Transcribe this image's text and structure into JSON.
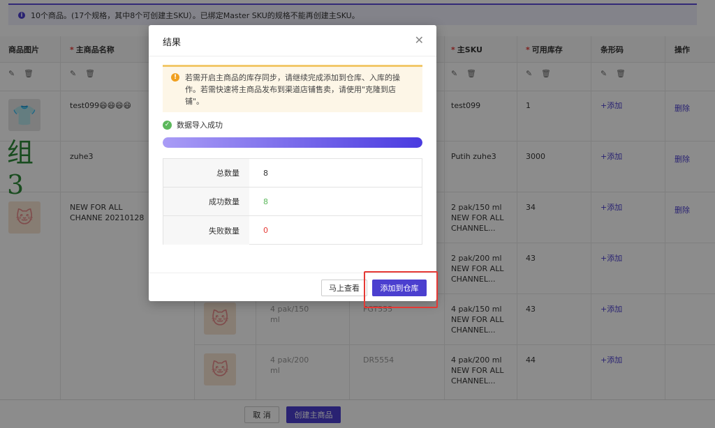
{
  "notice": {
    "icon": "info-icon",
    "text": "10个商品。(17个规格，其中8个可创建主SKU）。已绑定Master SKU的规格不能再创建主SKU。"
  },
  "table": {
    "headers": {
      "image": "商品图片",
      "name": "主商品名称",
      "sku": "主SKU",
      "stock": "可用库存",
      "barcode": "条形码",
      "action": "操作"
    },
    "rows": [
      {
        "name": "test099😄😄😄😄",
        "sku": "test099",
        "stock": "1",
        "barcode": "+添加",
        "action": "删除"
      },
      {
        "name": "zuhe3",
        "image_text": "组3",
        "sku": "Putih zuhe3",
        "stock": "3000",
        "barcode": "+添加",
        "action": "删除"
      },
      {
        "name": "NEW FOR ALL CHANNE 20210128",
        "sku": "2 pak/150 ml NEW FOR ALL CHANNEL...",
        "stock": "34",
        "barcode": "+添加",
        "action": "删除"
      },
      {
        "sku": "2 pak/200 ml NEW FOR ALL CHANNEL...",
        "stock": "43",
        "barcode": "+添加"
      },
      {
        "variant": "4 pak/150 ml",
        "code": "FGT555",
        "sku": "4 pak/150 ml NEW FOR ALL CHANNEL...",
        "stock": "43",
        "barcode": "+添加"
      },
      {
        "variant": "4 pak/200 ml",
        "code": "DR5554",
        "sku": "4 pak/200 ml NEW FOR ALL CHANNEL...",
        "stock": "44",
        "barcode": "+添加"
      }
    ]
  },
  "footer": {
    "cancel": "取 消",
    "create": "创建主商品"
  },
  "modal": {
    "title": "结果",
    "warning": "若需开启主商品的库存同步，请继续完成添加到仓库、入库的操作。若需快速将主商品发布到渠道店铺售卖，请使用\"克隆到店铺\"。",
    "success": "数据导入成功",
    "progress": 1.0,
    "stats": [
      {
        "label": "总数量",
        "value": "8"
      },
      {
        "label": "成功数量",
        "value": "8"
      },
      {
        "label": "失败数量",
        "value": "0"
      }
    ],
    "view_now": "马上查看",
    "add_to_warehouse": "添加到仓库"
  },
  "colors": {
    "primary": "#4b3fcf",
    "success": "#5cb85c",
    "danger": "#e53935",
    "warning": "#f0a020"
  }
}
